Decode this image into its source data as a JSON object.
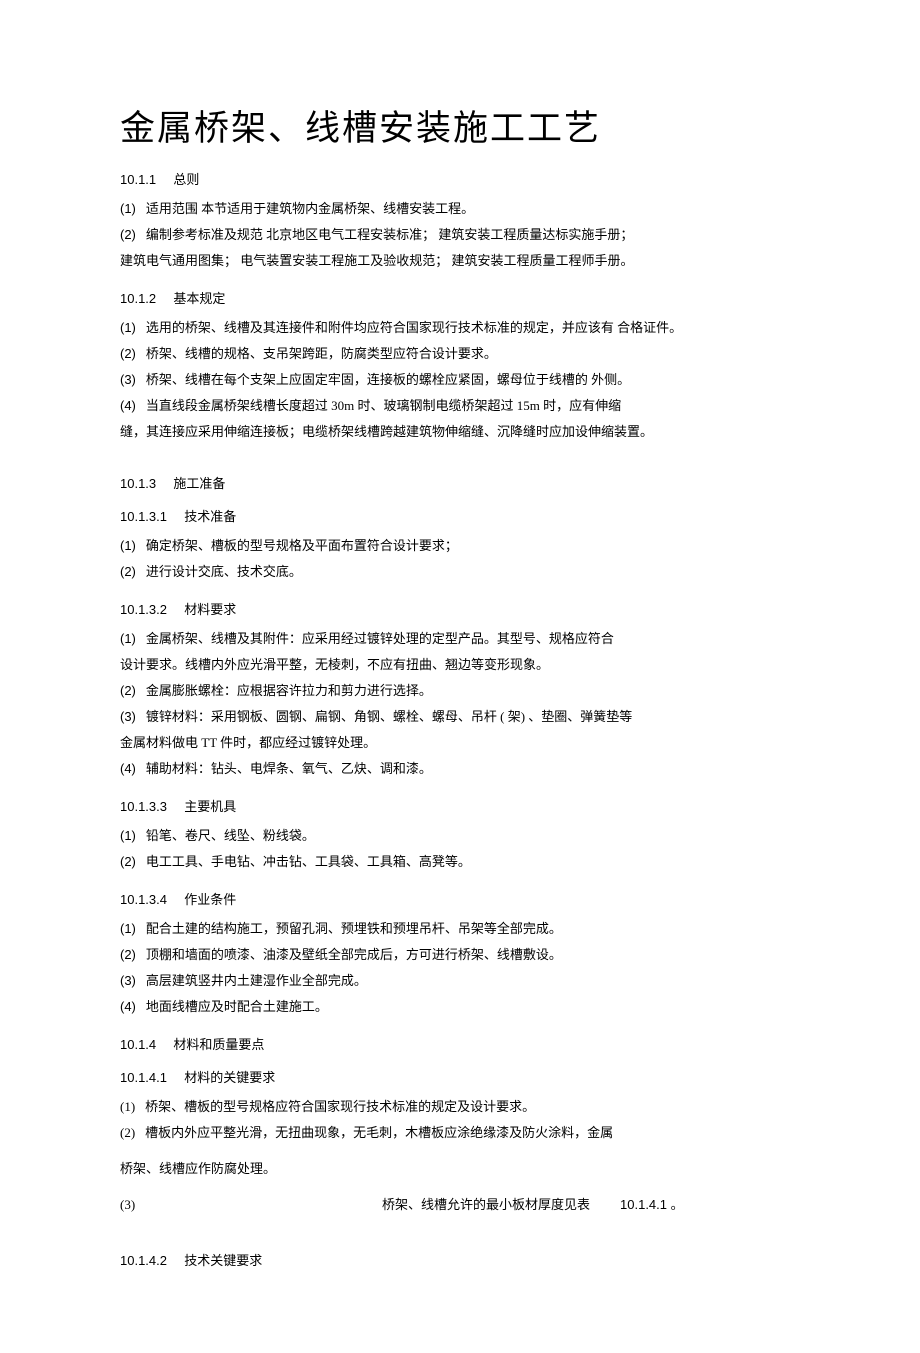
{
  "title": "金属桥架、线槽安装施工工艺",
  "s1": {
    "num": "10.1.1",
    "label": "总则"
  },
  "s1_items": [
    "适用范围  本节适用于建筑物内金属桥架、线槽安装工程。",
    "编制参考标准及规范  北京地区电气工程安装标准；  建筑安装工程质量达标实施手册；"
  ],
  "s1_tail": "建筑电气通用图集；  电气装置安装工程施工及验收规范；  建筑安装工程质量工程师手册。",
  "s2": {
    "num": "10.1.2",
    "label": "基本规定"
  },
  "s2_items": [
    "选用的桥架、线槽及其连接件和附件均应符合国家现行技术标准的规定，并应该有 合格证件。",
    "桥架、线槽的规格、支吊架跨距，防腐类型应符合设计要求。",
    "桥架、线槽在每个支架上应固定牢固，连接板的螺栓应紧固，螺母位于线槽的 外侧。",
    "当直线段金属桥架线槽长度超过 30m 时、玻璃钢制电缆桥架超过 15m 时，应有伸缩"
  ],
  "s2_tail": "缝，其连接应采用伸缩连接板；电缆桥架线槽跨越建筑物伸缩缝、沉降缝时应加设伸缩装置。",
  "s3": {
    "num": "10.1.3",
    "label": "施工准备"
  },
  "s31": {
    "num": "10.1.3.1",
    "label": "技术准备"
  },
  "s31_items": [
    "确定桥架、槽板的型号规格及平面布置符合设计要求；",
    "进行设计交底、技术交底。"
  ],
  "s32": {
    "num": "10.1.3.2",
    "label": "材料要求"
  },
  "s32_items": [
    "金属桥架、线槽及其附件：应采用经过镀锌处理的定型产品。其型号、规格应符合"
  ],
  "s32_tail1": "设计要求。线槽内外应光滑平整，无棱刺，不应有扭曲、翘边等变形现象。",
  "s32_items2": [
    "金属膨胀螺栓：应根据容许拉力和剪力进行选择。",
    "镀锌材料：采用钢板、圆钢、扁钢、角钢、螺栓、螺母、吊杆      ( 架) 、垫圈、弹簧垫等"
  ],
  "s32_tail2": "金属材料做电 TT 件时，都应经过镀锌处理。",
  "s32_items3": [
    "辅助材料：钻头、电焊条、氧气、乙炔、调和漆。"
  ],
  "s33": {
    "num": "10.1.3.3",
    "label": "主要机具"
  },
  "s33_items": [
    "铅笔、卷尺、线坠、粉线袋。",
    "电工工具、手电钻、冲击钻、工具袋、工具箱、高凳等。"
  ],
  "s34": {
    "num": "10.1.3.4",
    "label": "作业条件"
  },
  "s34_items": [
    "配合土建的结构施工，预留孔洞、预埋铁和预埋吊杆、吊架等全部完成。",
    "顶棚和墙面的喷漆、油漆及壁纸全部完成后，方可进行桥架、线槽敷设。",
    "高层建筑竖井内土建湿作业全部完成。",
    "地面线槽应及时配合土建施工。"
  ],
  "s4": {
    "num": "10.1.4",
    "label": "材料和质量要点"
  },
  "s41": {
    "num": "10.1.4.1",
    "label": "材料的关键要求"
  },
  "s41_items": [
    " 桥架、槽板的型号规格应符合国家现行技术标准的规定及设计要求。",
    "   槽板内外应平整光滑，无扭曲现象，无毛刺，木槽板应涂绝缘漆及防火涂料，金属"
  ],
  "s41_tail": "桥架、线槽应作防腐处理。",
  "s41_tableref": {
    "lead": "(3)",
    "mid": "桥架、线槽允许的最小板材厚度见表",
    "tail": "10.1.4.1 。"
  },
  "s42": {
    "num": "10.1.4.2",
    "label": "技术关键要求"
  }
}
